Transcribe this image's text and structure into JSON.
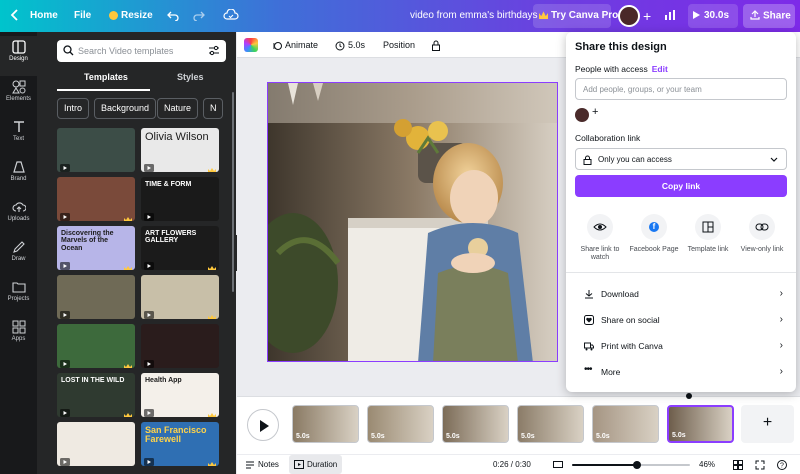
{
  "topbar": {
    "home": "Home",
    "file": "File",
    "resize": "Resize",
    "doc_title": "video from emma's birthdays",
    "try_pro": "Try Canva Pro",
    "duration": "30.0s",
    "share": "Share"
  },
  "rail": [
    {
      "label": "Design",
      "icon": "design-icon"
    },
    {
      "label": "Elements",
      "icon": "elements-icon"
    },
    {
      "label": "Text",
      "icon": "text-icon"
    },
    {
      "label": "Brand",
      "icon": "brand-icon"
    },
    {
      "label": "Uploads",
      "icon": "uploads-icon"
    },
    {
      "label": "Draw",
      "icon": "draw-icon"
    },
    {
      "label": "Projects",
      "icon": "projects-icon"
    },
    {
      "label": "Apps",
      "icon": "apps-icon"
    }
  ],
  "panel": {
    "search_placeholder": "Search Video templates",
    "tabs": [
      "Templates",
      "Styles"
    ],
    "chips": [
      "Intro",
      "Background",
      "Nature",
      "N"
    ],
    "thumbs": [
      {
        "text": "",
        "bg": "#3c4d47"
      },
      {
        "text": "Olivia Wilson",
        "bg": "#e9e9e9"
      },
      {
        "text": "",
        "bg": "#7a4a3a"
      },
      {
        "text": "TIME & FORM",
        "bg": "#1a1a1a"
      },
      {
        "text": "Discovering the Marvels of the Ocean",
        "bg": "#b7b5e8"
      },
      {
        "text": "ART FLOWERS GALLERY",
        "bg": "#1b1b1b"
      },
      {
        "text": "",
        "bg": "#6f6a56"
      },
      {
        "text": "",
        "bg": "#c8bfa8"
      },
      {
        "text": "",
        "bg": "#3d6a3c"
      },
      {
        "text": "",
        "bg": "#2a1c1c"
      },
      {
        "text": "LOST IN THE WILD",
        "bg": "#2f3a30"
      },
      {
        "text": "Health App",
        "bg": "#f4f0ea"
      },
      {
        "text": "",
        "bg": "#efeae2"
      },
      {
        "text": "San Francisco Farewell",
        "bg": "#2f6fb3"
      }
    ]
  },
  "toolbar": {
    "animate": "Animate",
    "duration": "5.0s",
    "position": "Position"
  },
  "timeline": {
    "clips": [
      "5.0s",
      "5.0s",
      "5.0s",
      "5.0s",
      "5.0s",
      "5.0s"
    ],
    "add": "+"
  },
  "footer": {
    "notes": "Notes",
    "duration": "Duration",
    "time": "0:26 / 0:30",
    "zoom": "46%",
    "zoom_fraction": 0.55
  },
  "share": {
    "title": "Share this design",
    "people_label": "People with access",
    "edit": "Edit",
    "add_placeholder": "Add people, groups, or your team",
    "collab_label": "Collaboration link",
    "access": "Only you can access",
    "copy": "Copy link",
    "options": [
      "Share link to watch",
      "Facebook Page",
      "Template link",
      "View-only link"
    ],
    "rows": [
      "Download",
      "Share on social",
      "Print with Canva",
      "More"
    ]
  },
  "colors": {
    "accent": "#8b3dff"
  }
}
